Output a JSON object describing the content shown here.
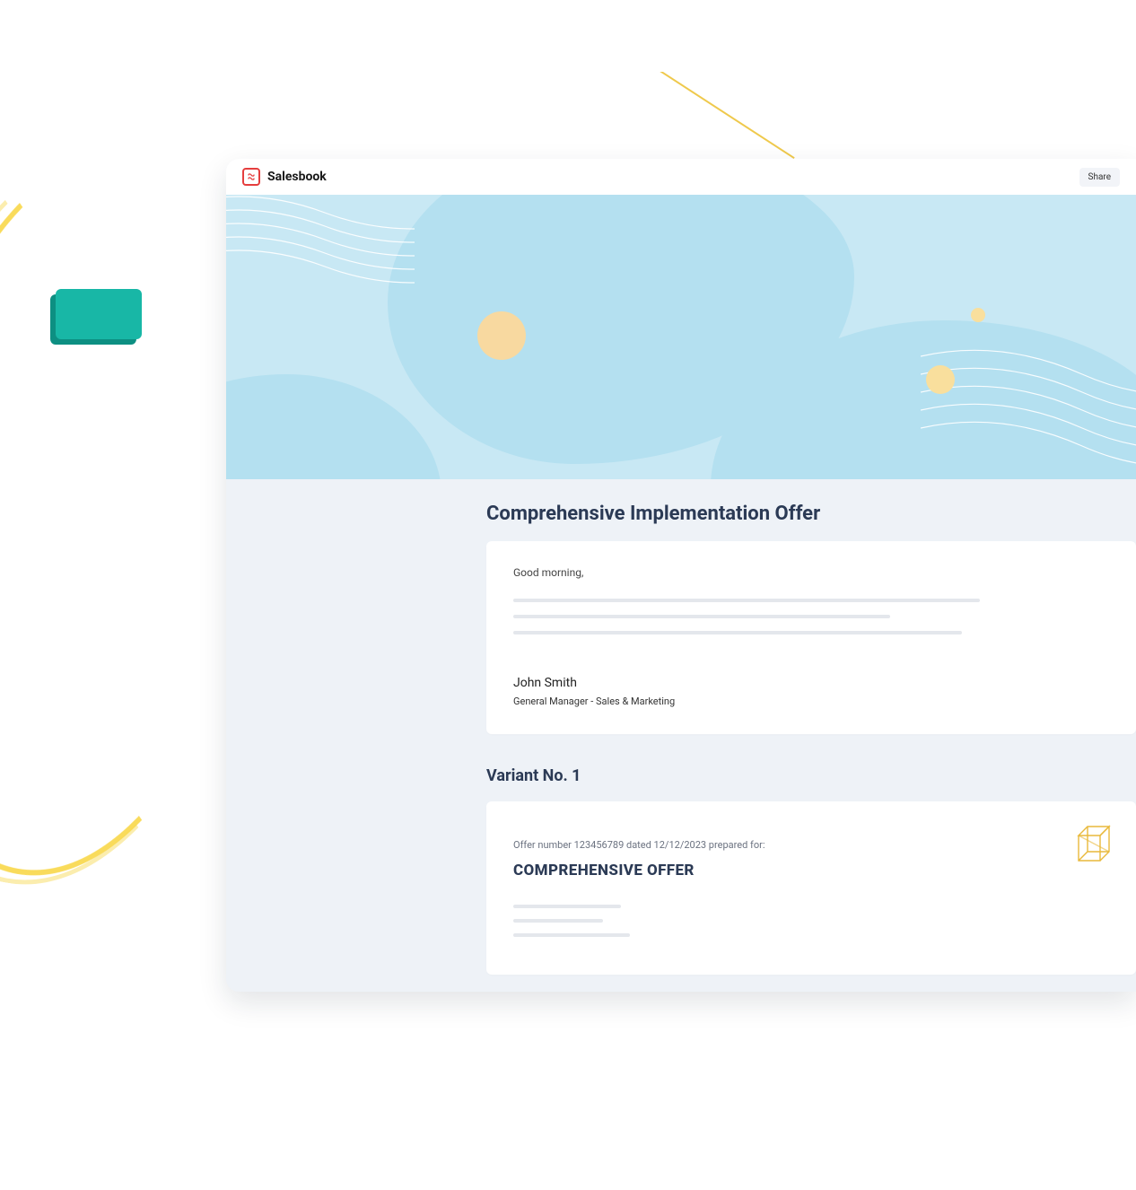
{
  "app": {
    "name": "Salesbook",
    "share_label": "Share"
  },
  "offer": {
    "title": "Comprehensive Implementation Offer",
    "greeting": "Good morning,",
    "signer_name": "John Smith",
    "signer_title": "General Manager - Sales & Marketing"
  },
  "variant": {
    "heading": "Variant No. 1",
    "meta": "Offer number 123456789 dated 12/12/2023 prepared for:",
    "offer_name": "COMPREHENSIVE OFFER"
  }
}
